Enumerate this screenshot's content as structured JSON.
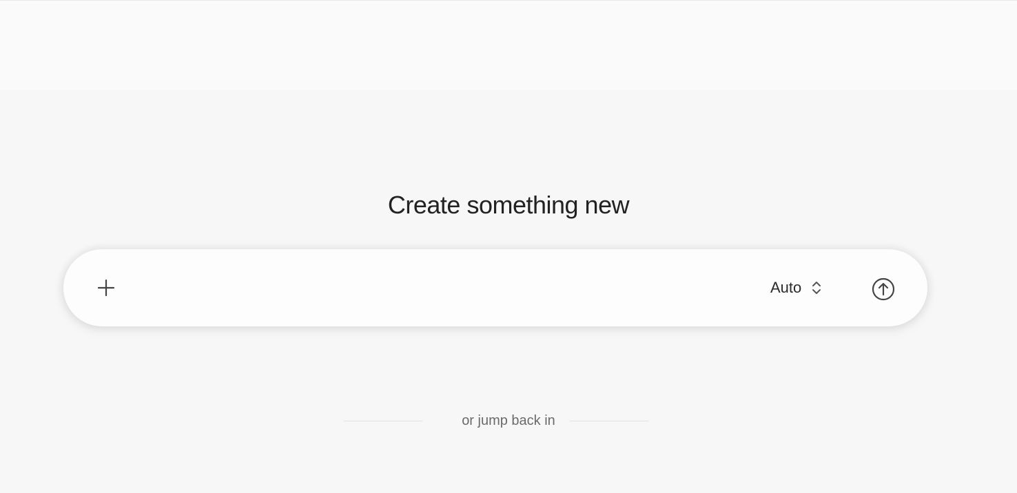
{
  "header": {
    "title": "Create something new"
  },
  "composer": {
    "input_value": "",
    "input_placeholder": "",
    "attach_icon": "plus-icon",
    "model_selector": {
      "selected": "Auto",
      "icon": "chevron-up-down-icon"
    },
    "submit_icon": "arrow-up-circle-icon"
  },
  "divider": {
    "text": "or jump back in"
  }
}
